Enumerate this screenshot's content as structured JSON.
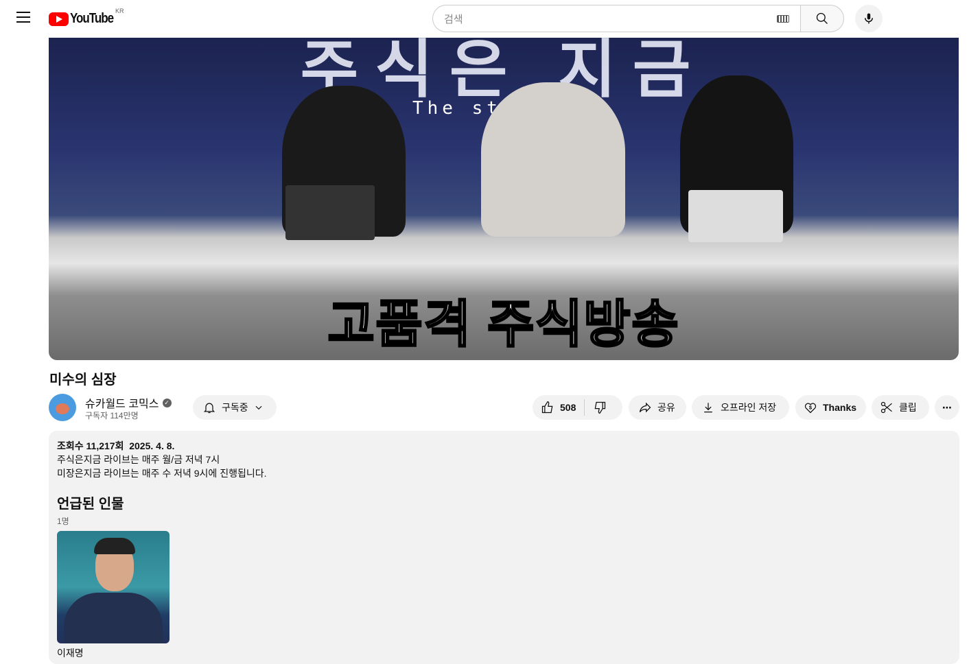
{
  "header": {
    "logo_text": "YouTube",
    "region": "KR",
    "search_placeholder": "검색"
  },
  "video": {
    "overlay_top": "주식은 지금",
    "overlay_sub": "The stock now",
    "caption": "고품격 주식방송"
  },
  "title": "미수의 심장",
  "channel": {
    "name": "슈카월드 코믹스",
    "subscribers": "구독자 114만명",
    "subscribe_label": "구독중"
  },
  "actions": {
    "likes": "508",
    "share": "공유",
    "download": "오프라인 저장",
    "thanks": "Thanks",
    "clip": "클립"
  },
  "description": {
    "stats": "조회수 11,217회  2025. 4. 8.",
    "lines": [
      "주식은지금 라이브는 매주 월/금 저녁 7시",
      "미장은지금 라이브는 매주 수 저녁 9시에 진행됩니다."
    ]
  },
  "people": {
    "heading": "언급된 인물",
    "count": "1명",
    "items": [
      {
        "name": "이재명"
      }
    ]
  }
}
